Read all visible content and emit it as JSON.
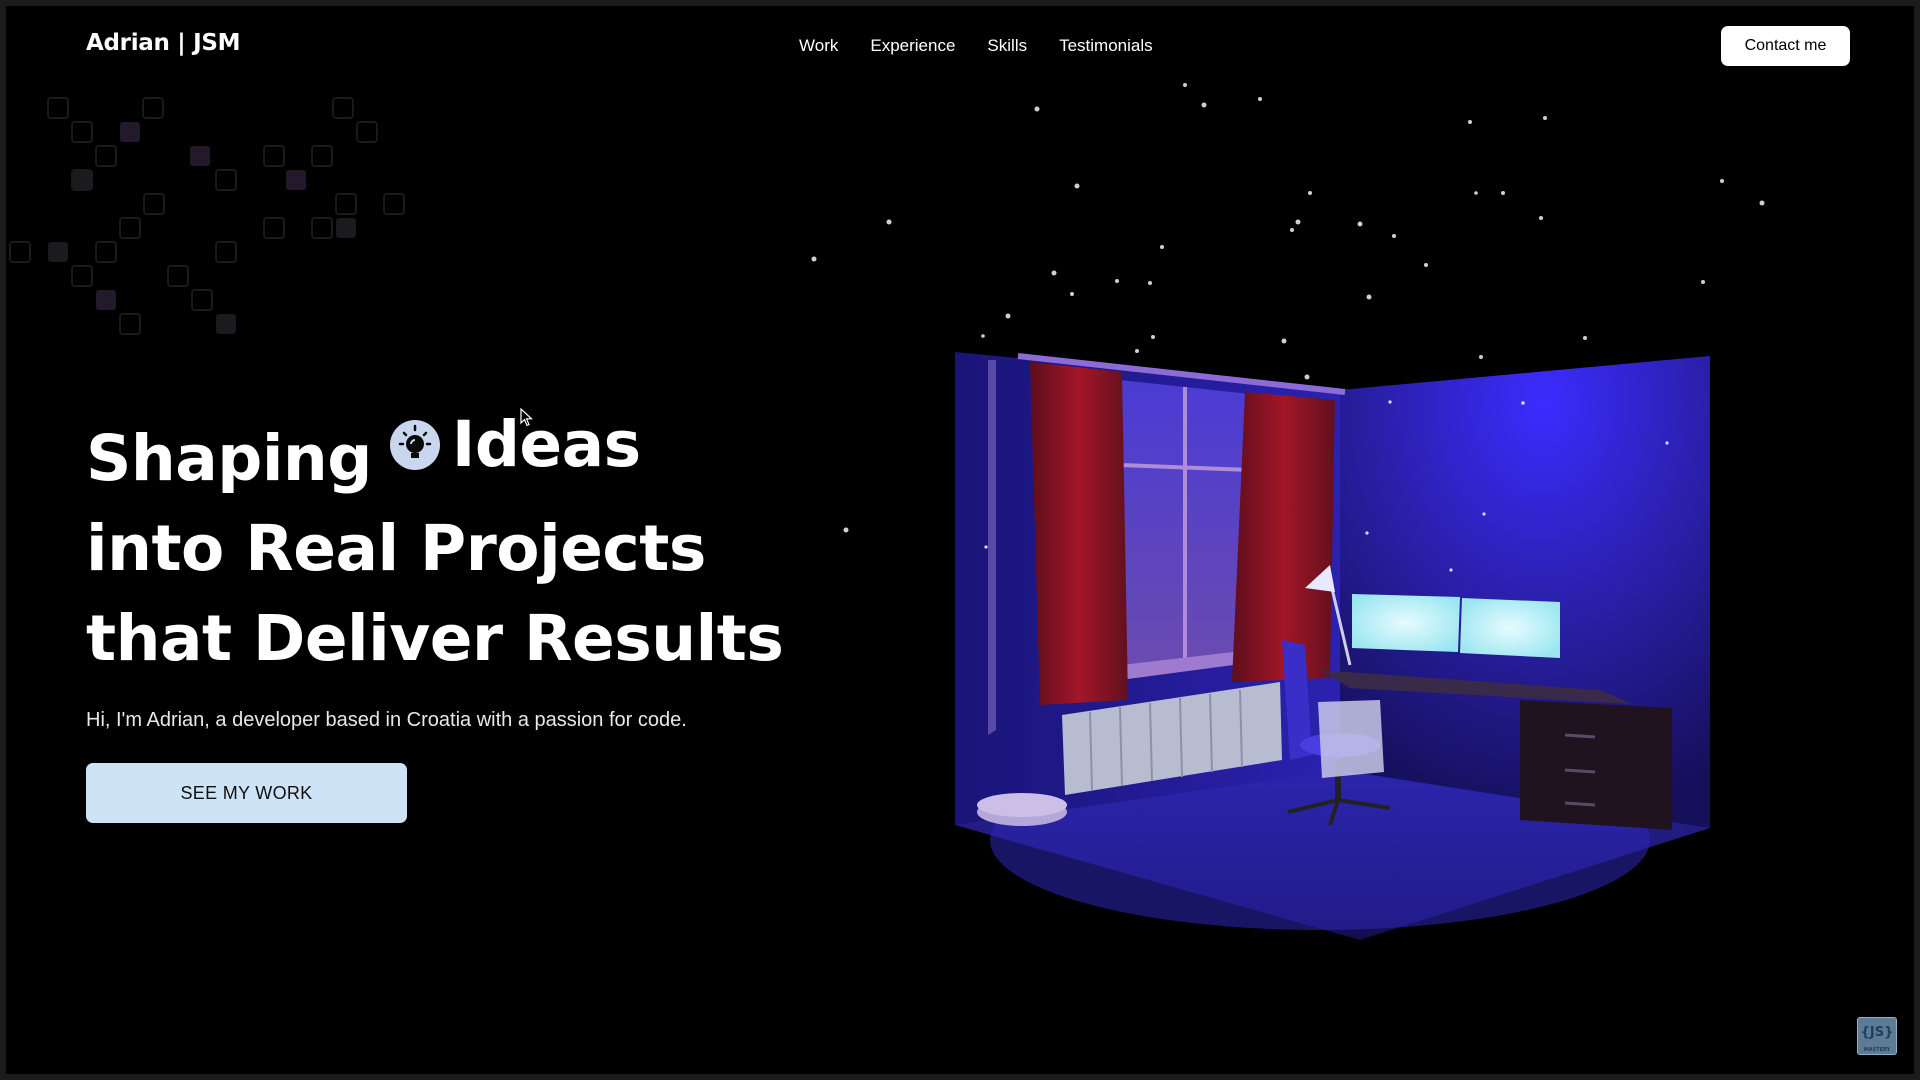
{
  "nav": {
    "brand": "Adrian | JSM",
    "links": [
      "Work",
      "Experience",
      "Skills",
      "Testimonials"
    ],
    "contact_label": "Contact me"
  },
  "hero": {
    "line1_word1": "Shaping",
    "line1_word2": "Ideas",
    "line2": "into Real Projects",
    "line3": "that Deliver Results",
    "subtitle": "Hi, I'm Adrian, a developer based in Croatia with a passion for code.",
    "cta_label": "SEE MY WORK"
  },
  "badge": {
    "logo_text": "{JS}",
    "logo_caption": "MASTERY"
  },
  "icons": {
    "idea": "lightbulb-icon",
    "cursor": "mouse-cursor-icon"
  },
  "colors": {
    "background": "#000000",
    "cta_background": "#cfe3f7",
    "room_wall": "#2a1fa8",
    "curtain": "#8e1322",
    "monitor_glow": "#c9f6ff"
  }
}
